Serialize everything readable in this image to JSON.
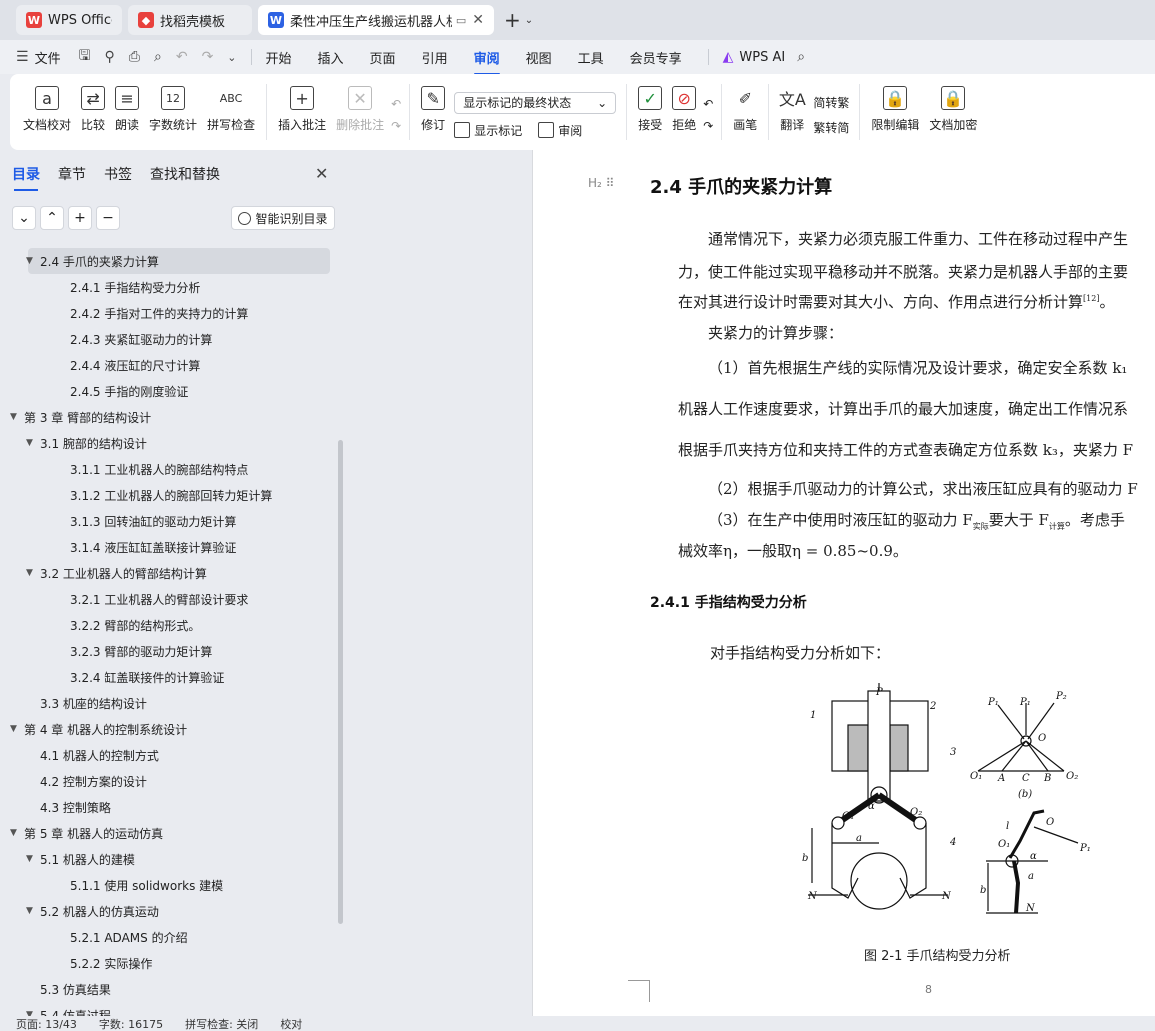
{
  "tabs": [
    {
      "label": "WPS Office",
      "logo": "W",
      "color": "#e8413d"
    },
    {
      "label": "找稻壳模板",
      "logo": "稻",
      "color": "#e8413d"
    },
    {
      "label": "柔性冲压生产线搬运机器人机械",
      "logo": "W",
      "color": "#2d62e3"
    }
  ],
  "menu": {
    "file": "文件",
    "items": [
      "开始",
      "插入",
      "页面",
      "引用",
      "审阅",
      "视图",
      "工具",
      "会员专享"
    ],
    "active": "审阅",
    "ai": "WPS AI"
  },
  "ribbon": {
    "doc_check": "文档校对",
    "compare": "比较",
    "read_aloud": "朗读",
    "word_count": "字数统计",
    "spell_check": "拼写检查",
    "insert_comment": "插入批注",
    "delete_comment": "删除批注",
    "markup_state": "显示标记的最终状态",
    "revise": "修订",
    "show_markup": "显示标记",
    "review": "审阅",
    "accept": "接受",
    "reject": "拒绝",
    "pen": "画笔",
    "translate": "翻译",
    "to_traditional": "简转繁",
    "to_simplified": "繁转简",
    "restrict_edit": "限制编辑",
    "doc_encrypt": "文档加密"
  },
  "nav": {
    "tabs": [
      "目录",
      "章节",
      "书签",
      "查找和替换"
    ],
    "smart_toc": "智能识别目录",
    "toc": [
      {
        "level": 2,
        "text": "2.4  手爪的夹紧力计算",
        "arrow": true,
        "selected": true
      },
      {
        "level": 3,
        "text": "2.4.1  手指结构受力分析"
      },
      {
        "level": 3,
        "text": "2.4.2 手指对工件的夹持力的计算"
      },
      {
        "level": 3,
        "text": "2.4.3 夹紧缸驱动力的计算"
      },
      {
        "level": 3,
        "text": "2.4.4 液压缸的尺寸计算"
      },
      {
        "level": 3,
        "text": "2.4.5 手指的刚度验证"
      },
      {
        "level": 1,
        "text": "第 3 章    臂部的结构设计",
        "arrow": true
      },
      {
        "level": 2,
        "text": "3.1  腕部的结构设计",
        "arrow": true
      },
      {
        "level": 3,
        "text": "3.1.1 工业机器人的腕部结构特点"
      },
      {
        "level": 3,
        "text": "3.1.2 工业机器人的腕部回转力矩计算"
      },
      {
        "level": 3,
        "text": "3.1.3  回转油缸的驱动力矩计算"
      },
      {
        "level": 3,
        "text": "3.1.4  液压缸缸盖联接计算验证"
      },
      {
        "level": 2,
        "text": "3.2  工业机器人的臂部结构计算",
        "arrow": true
      },
      {
        "level": 3,
        "text": "3.2.1 工业机器人的臂部设计要求"
      },
      {
        "level": 3,
        "text": "3.2.2 臂部的结构形式。"
      },
      {
        "level": 3,
        "text": "3.2.3 臂部的驱动力矩计算"
      },
      {
        "level": 3,
        "text": "3.2.4 缸盖联接件的计算验证"
      },
      {
        "level": 2,
        "text": "3.3  机座的结构设计"
      },
      {
        "level": 1,
        "text": "第 4 章    机器人的控制系统设计",
        "arrow": true
      },
      {
        "level": 2,
        "text": "4.1 机器人的控制方式"
      },
      {
        "level": 2,
        "text": "4.2 控制方案的设计"
      },
      {
        "level": 2,
        "text": "4.3 控制策略"
      },
      {
        "level": 1,
        "text": "第 5 章     机器人的运动仿真",
        "arrow": true
      },
      {
        "level": 2,
        "text": "5.1 机器人的建模",
        "arrow": true
      },
      {
        "level": 3,
        "text": "5.1.1  使用 solidworks 建模"
      },
      {
        "level": 2,
        "text": "5.2  机器人的仿真运动",
        "arrow": true
      },
      {
        "level": 3,
        "text": "5.2.1 ADAMS 的介绍"
      },
      {
        "level": 3,
        "text": "5.2.2 实际操作"
      },
      {
        "level": 2,
        "text": "5.3  仿真结果"
      },
      {
        "level": 2,
        "text": "5.4  仿真过程",
        "arrow": true
      }
    ]
  },
  "doc": {
    "h2_mark": "H₂",
    "heading": "2.4  手爪的夹紧力计算",
    "p1": "通常情况下，夹紧力必须克服工件重力、工件在移动过程中产生",
    "p2": "力，使工件能过实现平稳移动并不脱落。夹紧力是机器人手部的主要",
    "p3": "在对其进行设计时需要对其大小、方向、作用点进行分析计算",
    "p3_ref": "[12]",
    "p3_end": "。",
    "p4": "夹紧力的计算步骤：",
    "p5": "（1）首先根据生产线的实际情况及设计要求，确定安全系数 k₁",
    "p6": "机器人工作速度要求，计算出手爪的最大加速度，确定出工作情况系",
    "p7": "根据手爪夹持方位和夹持工件的方式查表确定方位系数 k₃，夹紧力 F",
    "p8": "（2）根据手爪驱动力的计算公式，求出液压缸应具有的驱动力 F",
    "p9_a": "（3）在生产中使用时液压缸的驱动力 F",
    "p9_sub1": "实际",
    "p9_b": "要大于 F",
    "p9_sub2": "计算",
    "p9_c": "。考虑手",
    "p10": "械效率η，一般取η = 0.85~0.9。",
    "h3": "2.4.1  手指结构受力分析",
    "p11": "对手指结构受力分析如下：",
    "caption": "图 2-1  手爪结构受力分析",
    "page_number": "8",
    "fig_labels": {
      "P": "P",
      "one": "1",
      "two": "2",
      "three": "3",
      "four": "4",
      "O1": "O₁",
      "O2": "O₂",
      "a": "a",
      "alpha": "α",
      "b": "b",
      "N": "N",
      "P1": "P₁",
      "P2": "P₂",
      "O": "O",
      "A": "A",
      "B": "B",
      "C": "C",
      "fig_b": "(b)",
      "l": "l"
    }
  },
  "status": {
    "page": "页面: 13/43",
    "words": "字数: 16175",
    "spell": "拼写检查: 关闭",
    "proof": "校对"
  }
}
